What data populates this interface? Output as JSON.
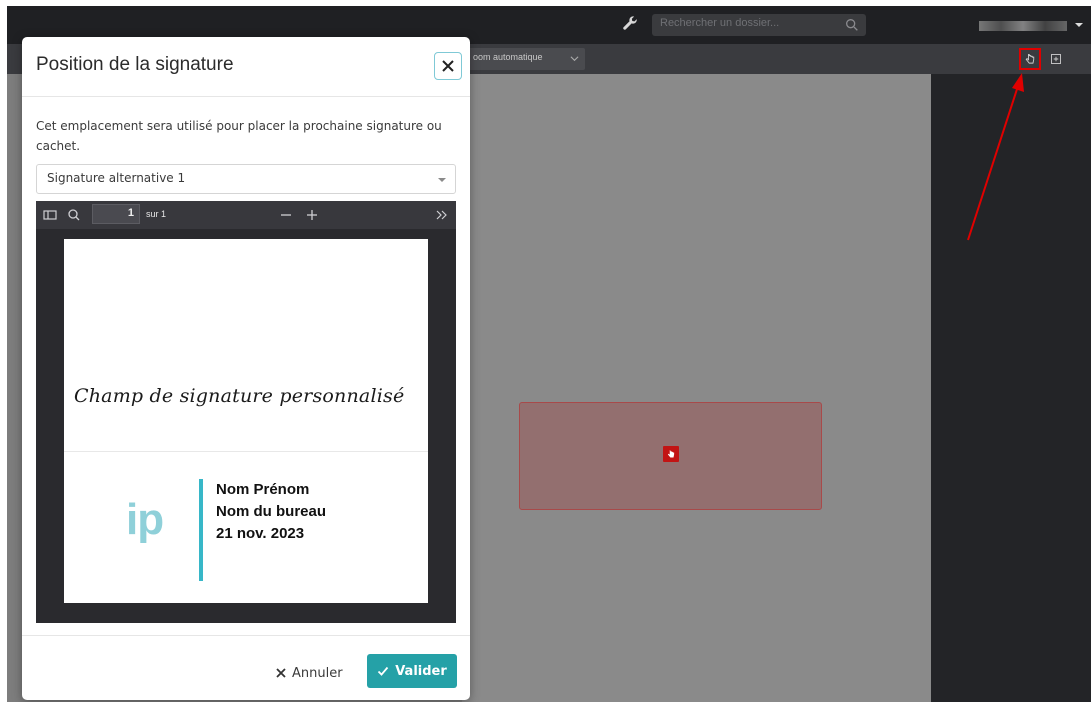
{
  "topbar": {
    "search_placeholder": "Rechercher un dossier..."
  },
  "toolbar": {
    "zoom_label": "oom automatique"
  },
  "modal": {
    "title": "Position de la signature",
    "description": "Cet emplacement sera utilisé pour placer la prochaine signature ou cachet.",
    "selected_option": "Signature alternative 1",
    "pdf": {
      "page_number": "1",
      "page_of": "sur 1",
      "custom_signature": "Champ de signature personnalisé",
      "logo": "ip",
      "stamp_lines": [
        "Nom Prénom",
        "Nom du bureau",
        "21 nov. 2023"
      ]
    },
    "cancel_label": "Annuler",
    "validate_label": "Valider"
  },
  "colors": {
    "accent": "#25a1a7",
    "highlight": "#e00000",
    "signature_zone": "#936f6f"
  }
}
